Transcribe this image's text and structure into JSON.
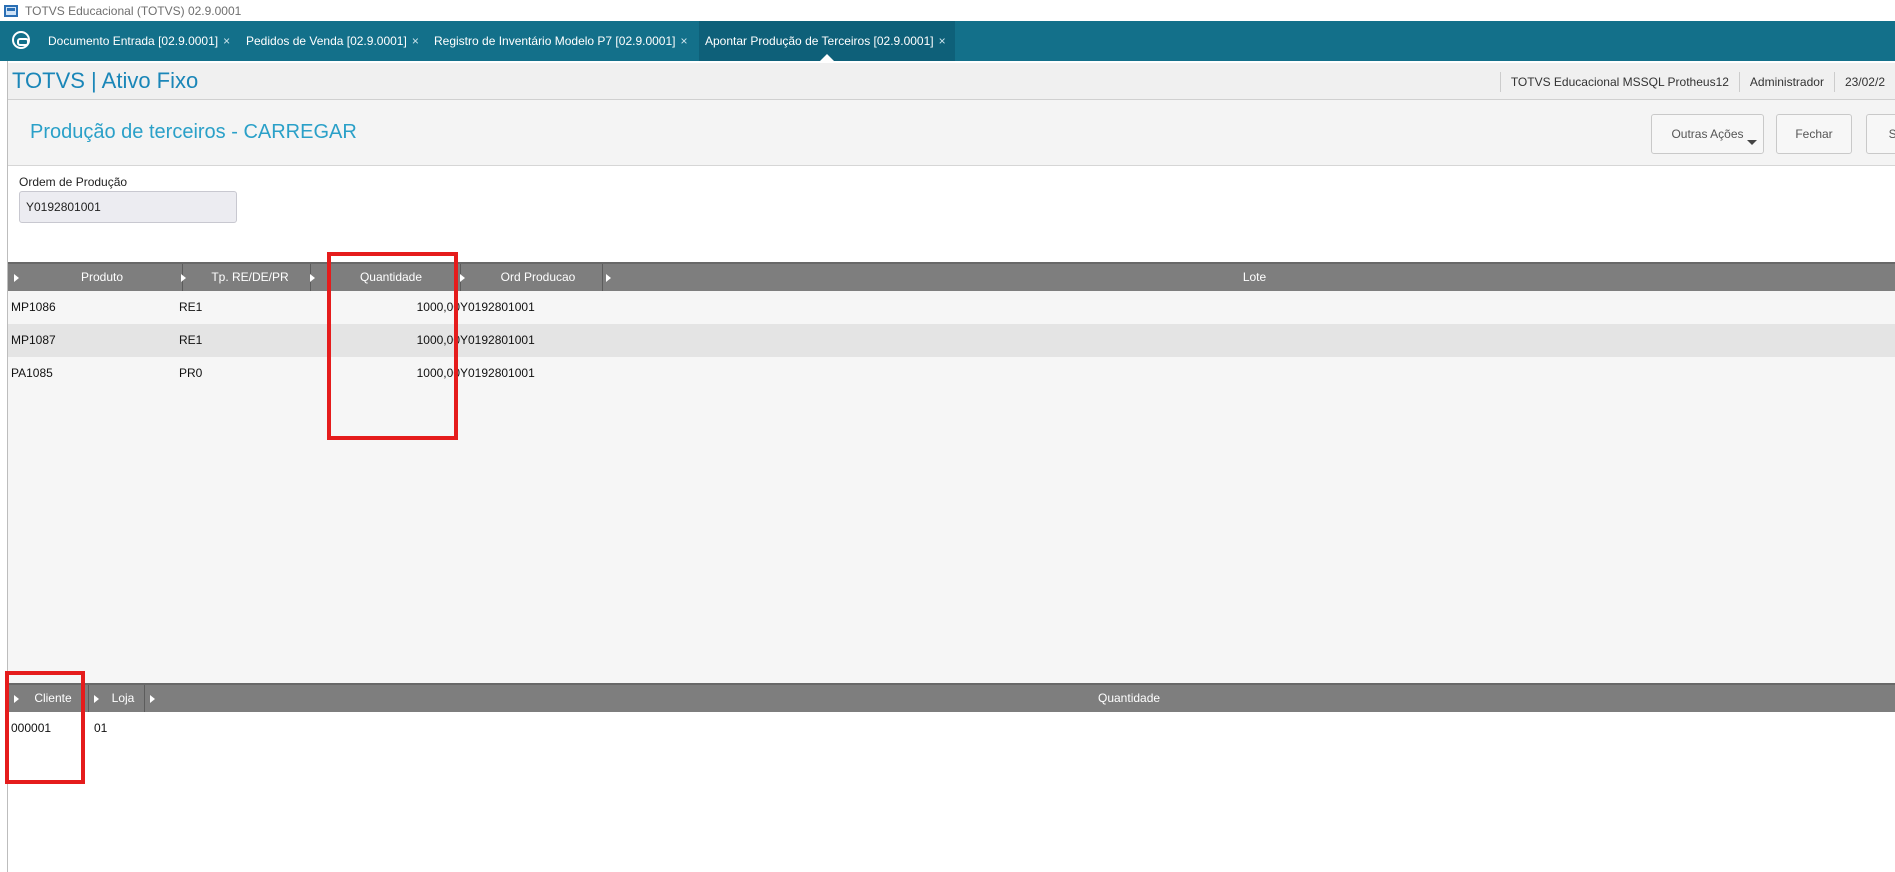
{
  "window": {
    "title": "TOTVS Educacional (TOTVS) 02.9.0001"
  },
  "tabs": [
    {
      "label": "Documento Entrada [02.9.0001]",
      "close": "×"
    },
    {
      "label": "Pedidos de Venda [02.9.0001]",
      "close": "×"
    },
    {
      "label": "Registro de Inventário Modelo P7 [02.9.0001]",
      "close": "×"
    },
    {
      "label": "Apontar Produção de Terceiros [02.9.0001]",
      "close": "×"
    }
  ],
  "header": {
    "brand": "TOTVS | Ativo Fixo",
    "environment": "TOTVS Educacional MSSQL Protheus12",
    "user": "Administrador",
    "date": "23/02/2"
  },
  "page": {
    "title": "Produção de terceiros - CARREGAR",
    "buttons": {
      "more_actions": "Outras Ações",
      "close": "Fechar",
      "save": "Sa"
    }
  },
  "form": {
    "order_label": "Ordem de Produção",
    "order_value": "Y0192801001"
  },
  "grid_top": {
    "columns": [
      "Produto",
      "Tp. RE/DE/PR",
      "Quantidade",
      "Ord Producao",
      "Lote"
    ],
    "rows": [
      [
        "MP1086",
        "RE1",
        "1000,00",
        "Y0192801001",
        ""
      ],
      [
        "MP1087",
        "RE1",
        "1000,00",
        "Y0192801001",
        ""
      ],
      [
        "PA1085",
        "PR0",
        "1000,00",
        "Y0192801001",
        ""
      ]
    ]
  },
  "grid_bottom": {
    "columns": [
      "Cliente",
      "Loja",
      "Quantidade"
    ],
    "rows": [
      [
        "000001",
        "01",
        ""
      ]
    ]
  },
  "colors": {
    "tabbar": "#13708a",
    "brand": "#1a86b8",
    "title": "#2aa0c8",
    "grid_header": "#7e7e7e",
    "highlight_box": "#e51c1c"
  }
}
